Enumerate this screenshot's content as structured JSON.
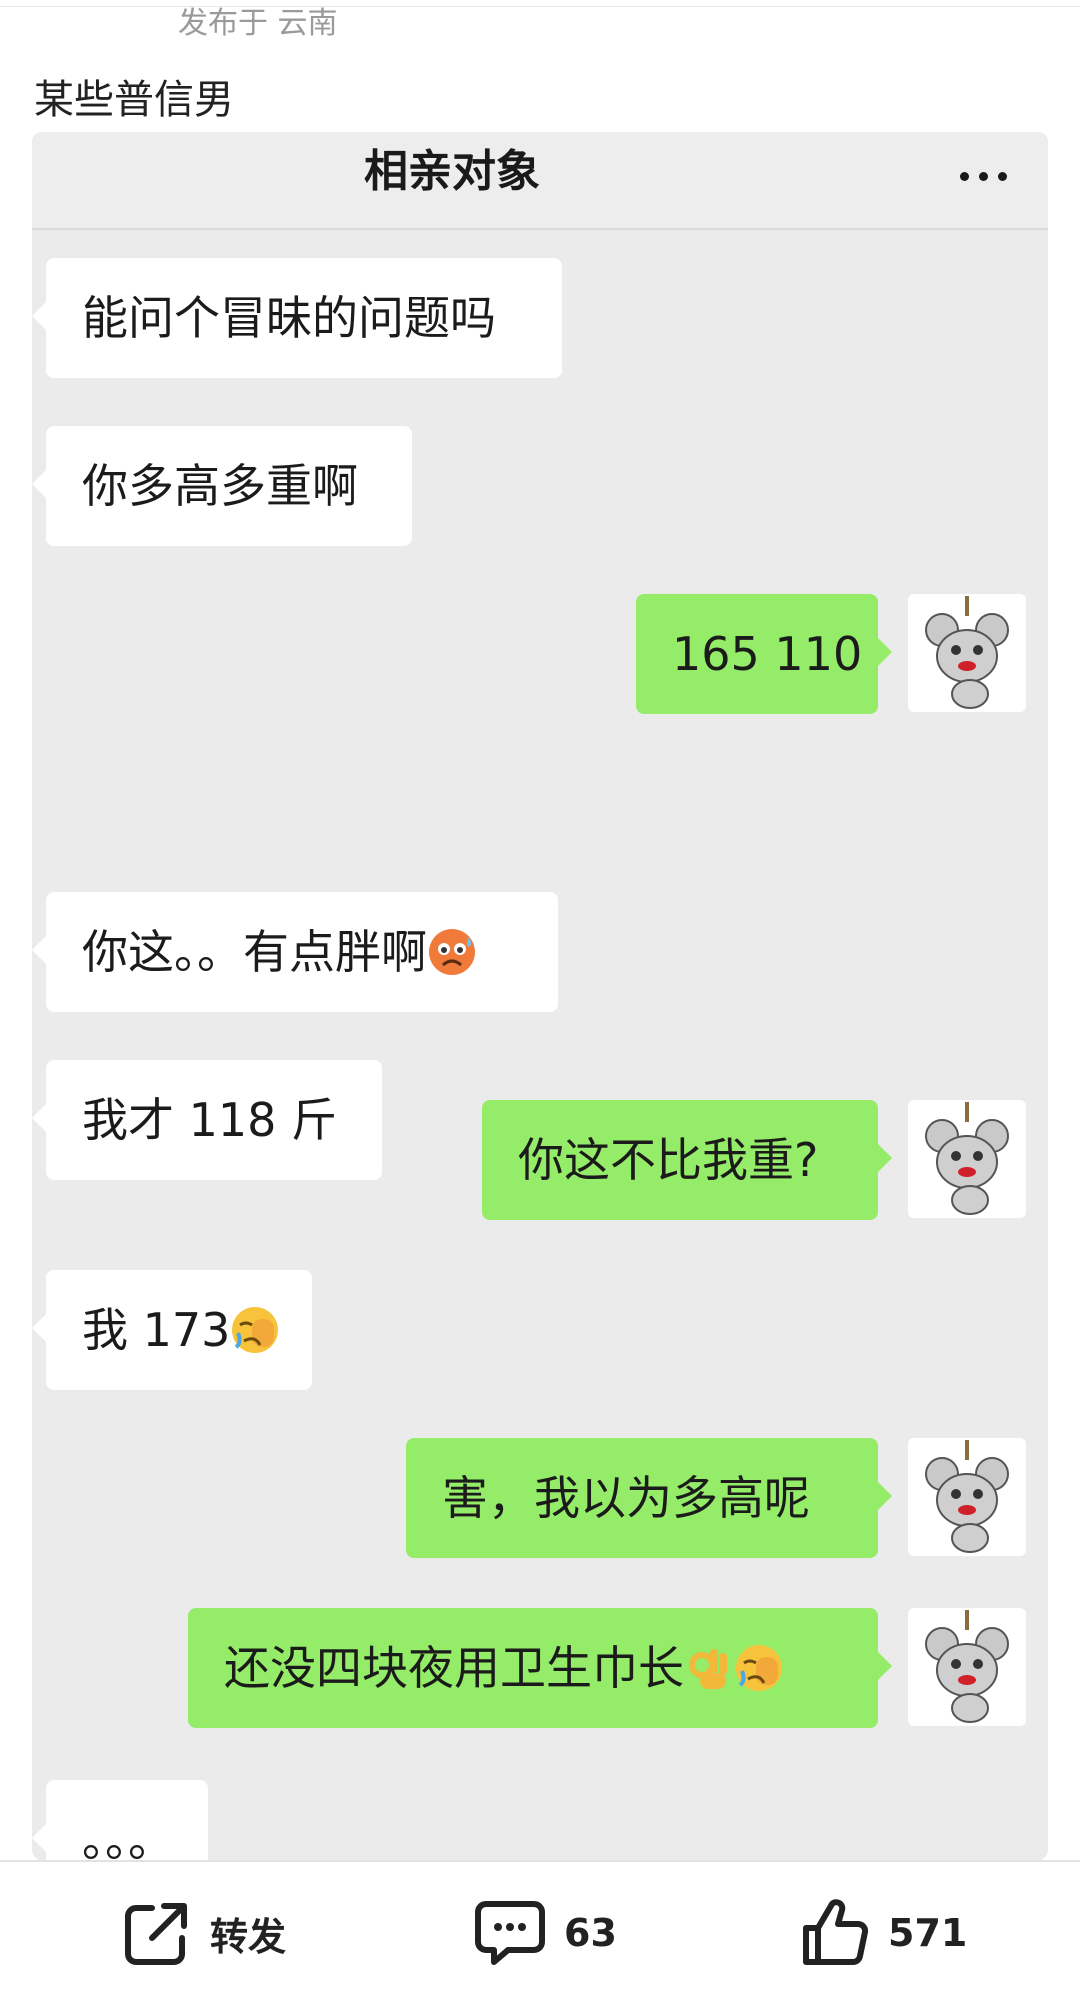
{
  "post": {
    "location": "发布于 云南",
    "title": "某些普信男"
  },
  "chat": {
    "title": "相亲对象",
    "more_icon": "more-dots-icon",
    "messages": [
      {
        "side": "left",
        "text": "能问个冒昧的问题吗"
      },
      {
        "side": "left",
        "text": "你多高多重啊"
      },
      {
        "side": "right",
        "text": "165 110"
      },
      {
        "side": "left",
        "text": "你这。。有点胖啊",
        "emoji": "angry-sweat-emoji"
      },
      {
        "side": "left",
        "text": "我才 118 斤"
      },
      {
        "side": "right",
        "text": "你这不比我重?"
      },
      {
        "side": "left",
        "text": "我 173",
        "emoji": "facepalm-cry-emoji"
      },
      {
        "side": "right",
        "text": "害，我以为多高呢"
      },
      {
        "side": "right",
        "text": "还没四块夜用卫生巾长",
        "emoji": "ok-hand-emoji, facepalm-cry-emoji"
      },
      {
        "side": "left",
        "text": "。。。"
      }
    ],
    "avatar_icon": "cartoon-mouse-avatar"
  },
  "actions": {
    "repost_label": "转发",
    "comment_count": "63",
    "like_count": "571",
    "repost_icon": "share-arrow-icon",
    "comment_icon": "comment-bubble-icon",
    "like_icon": "thumbs-up-icon"
  },
  "colors": {
    "chat_background": "#ebebeb",
    "self_bubble": "#95ec69",
    "other_bubble": "#ffffff"
  }
}
